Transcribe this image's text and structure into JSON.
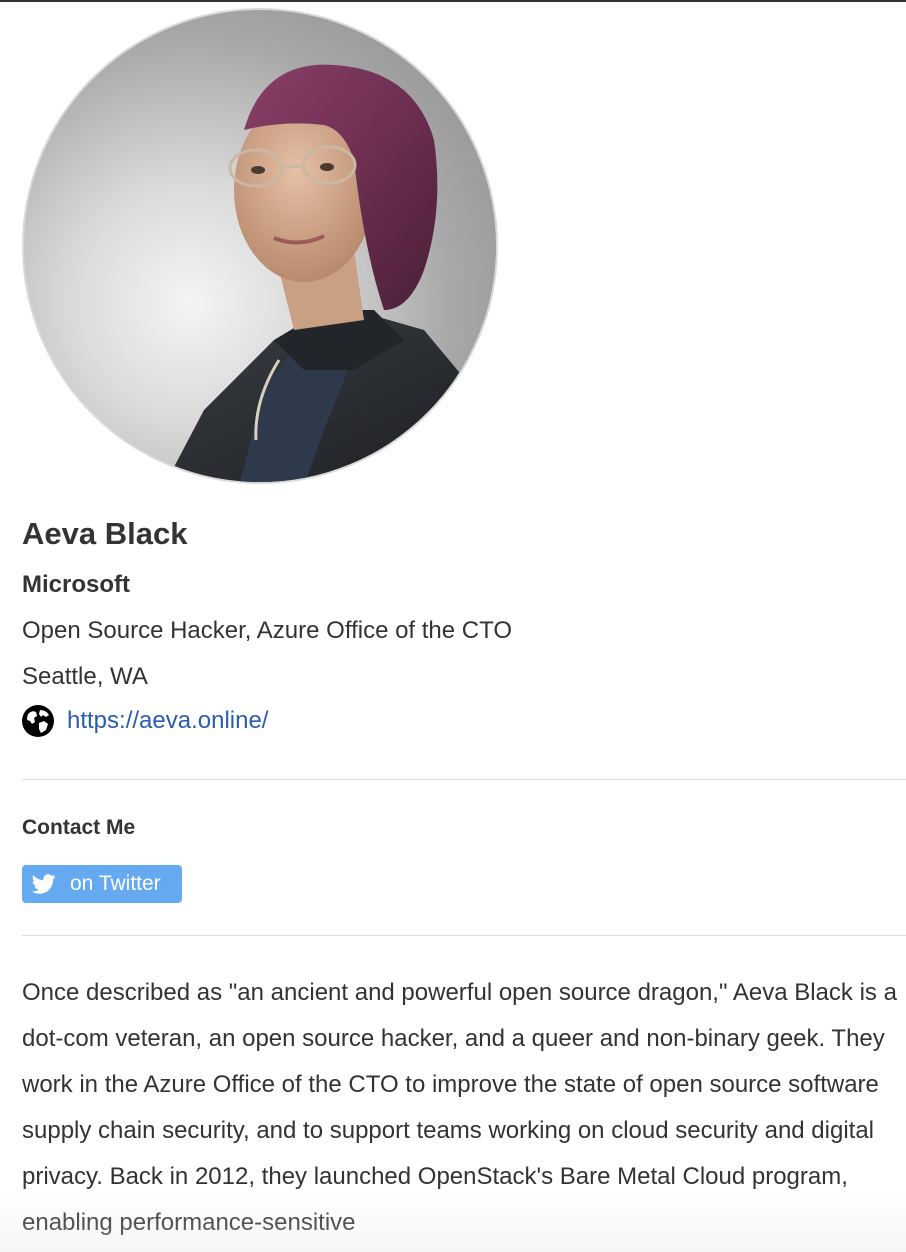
{
  "profile": {
    "avatar_alt": "Aeva Black",
    "name": "Aeva Black",
    "company": "Microsoft",
    "title": "Open Source Hacker, Azure Office of the CTO",
    "location": "Seattle, WA",
    "website_icon": "globe-icon",
    "website": "https://aeva.online/"
  },
  "contact": {
    "heading": "Contact Me",
    "twitter_icon": "twitter-bird-icon",
    "twitter_label": "on Twitter"
  },
  "bio": {
    "text": "Once described as \"an ancient and powerful open source dragon,\" Aeva Black is a dot-com veteran, an open source hacker, and a queer and non-binary geek. They work in the Azure Office of the CTO to improve the state of open source software supply chain security, and to support teams working on cloud security and digital privacy. Back in 2012, they launched OpenStack's Bare Metal Cloud program, enabling performance-sensitive"
  },
  "colors": {
    "text": "#333333",
    "link": "#2a5db0",
    "twitter_button": "#65aaf0",
    "divider": "#dddddd"
  }
}
